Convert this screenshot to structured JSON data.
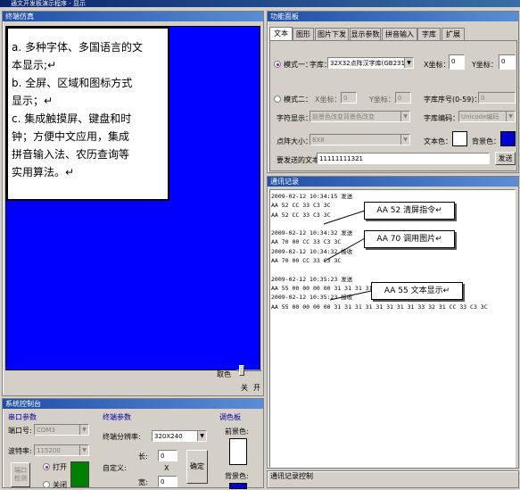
{
  "window": {
    "title": "通文开发板演示程序 - 显示"
  },
  "terminal": {
    "title": "终端仿真",
    "note_lines": [
      "a. 多种字体、多国语言的文",
      "本显示;↵",
      "b. 全屏、区域和图标方式",
      "显示；↵",
      "c. 集成触摸屏、键盘和时",
      "钟；方便中文应用，集成",
      "拼音输入法、农历查询等",
      "实用算法。↵"
    ],
    "invert_label": "取色",
    "off_label": "关",
    "on_label": "开"
  },
  "system": {
    "title": "系统控制台",
    "serial_title": "串口参数",
    "port_label": "端口号:",
    "port_value": "COM3",
    "baud_label": "波特率:",
    "baud_value": "115200",
    "open_btn": "端口\n检测",
    "radio_open": "打开",
    "radio_close": "关闭",
    "term_title": "终端参数",
    "res_label": "终端分辨率:",
    "res_value": "320X240",
    "custom_label": "自定义:",
    "long_label": "长:",
    "long_value": "0",
    "x_label": "X",
    "wide_label": "宽:",
    "wide_value": "0",
    "confirm_btn": "确定",
    "palette_title": "调色板",
    "fg_label": "前景色:",
    "bg_label": "背景色:",
    "palette_fg": "#ffffff",
    "palette_bg": "#0000cc"
  },
  "function": {
    "title": "功能面板",
    "tabs": [
      "文本",
      "图形",
      "图片下发",
      "显示参数",
      "拼音输入法",
      "字库",
      "扩展"
    ],
    "mode1_label": "模式一：",
    "font_label": "字库：",
    "font_value": "32X32点阵汉字库(GB2312",
    "x_coord_label": "X坐标：",
    "x_coord_value": "0",
    "y_coord_label": "Y坐标：",
    "y_coord_value": "0",
    "mode2_label": "模式二：",
    "x2_label": "X坐标：",
    "x2_value": "0",
    "y2_label": "Y坐标：",
    "y2_value": "0",
    "fontno_label": "字库序号(0-59)：",
    "fontno_value": "0",
    "chardisp_label": "字符显示：",
    "chardisp_value": "前景色改变背景色改变",
    "encoding_label": "字库编码：",
    "encoding_value": "Unicode编码",
    "dotsize_label": "点阵大小：",
    "dotsize_value": "8X8",
    "textcolor_label": "文本色：",
    "bgcolor_label": "背景色：",
    "text_color": "#ffffff",
    "bg_color": "#0000cc",
    "send_label": "要发送的文本：",
    "send_value": "11111111321",
    "send_btn": "发送"
  },
  "log": {
    "title": "通讯记录",
    "lines": [
      "2009-02-12 10:34:15  发送",
      "AA 52 CC 33 C3 3C",
      "AA 52 CC 33 C3 3C",
      "",
      "2009-02-12 10:34:32  发送",
      "AA 70 00 CC 33 C3 3C",
      "2009-02-12 10:34:32  接收",
      "AA 70 00 CC 33 C3 3C",
      "",
      "2009-02-12 10:35:23  发送",
      "AA 55 00 00 00 00 31 31 31 31 31",
      "2009-02-12 10:35:23  接收",
      "AA 55 00 00 00 00 31 31 31 31 31 31 31 31 33 32 31 CC 33 C3 3C"
    ],
    "callouts": [
      "AA 52 清屏指令↵",
      "AA 70 调用图片↵",
      "AA 55 文本显示↵"
    ],
    "control_title": "通讯记录控制"
  }
}
